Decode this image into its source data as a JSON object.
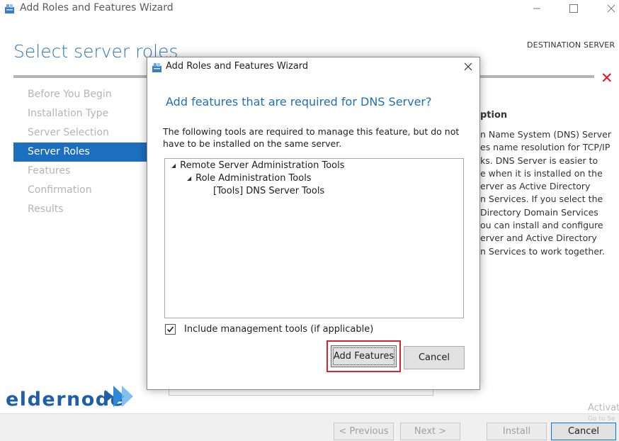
{
  "window": {
    "title": "Add Roles and Features Wizard"
  },
  "page": {
    "heading": "Select server roles",
    "destination_label": "DESTINATION SERVER"
  },
  "nav": {
    "items": [
      {
        "label": "Before You Begin",
        "active": false
      },
      {
        "label": "Installation Type",
        "active": false
      },
      {
        "label": "Server Selection",
        "active": false
      },
      {
        "label": "Server Roles",
        "active": true
      },
      {
        "label": "Features",
        "active": false
      },
      {
        "label": "Confirmation",
        "active": false
      },
      {
        "label": "Results",
        "active": false
      }
    ]
  },
  "description": {
    "heading": "ption",
    "text": "n Name System (DNS) Server\nes name resolution for TCP/IP\nks. DNS Server is easier to\ne when it is installed on the\nerver as Active Directory\nn Services. If you select the\nDirectory Domain Services\nou can install and configure\nerver and Active Directory\nn Services to work together."
  },
  "dialog": {
    "title": "Add Roles and Features Wizard",
    "heading": "Add features that are required for DNS Server?",
    "message": "The following tools are required to manage this feature, but do not have to be installed on the same server.",
    "tree": [
      {
        "label": "Remote Server Administration Tools",
        "level": 0,
        "expanded": true
      },
      {
        "label": "Role Administration Tools",
        "level": 1,
        "expanded": true
      },
      {
        "label": "[Tools] DNS Server Tools",
        "level": 2,
        "expanded": false
      }
    ],
    "include_tools_label": "Include management tools (if applicable)",
    "include_tools_checked": true,
    "add_button": "Add Features",
    "cancel_button": "Cancel"
  },
  "footer": {
    "previous": "< Previous",
    "next": "Next >",
    "install": "Install",
    "cancel": "Cancel"
  },
  "watermark": {
    "activate": "Activat",
    "activate_sub": "Go to Se"
  },
  "logo": {
    "text": "eldernode"
  },
  "colors": {
    "accent": "#1c6fbf",
    "heading": "#2b78b8",
    "highlight": "#d9232e",
    "error": "#e81123"
  },
  "icons": [
    "wizard-icon",
    "minimize-icon",
    "maximize-icon",
    "close-icon",
    "error-icon",
    "checkmark-icon",
    "expand-triangle-icon"
  ]
}
